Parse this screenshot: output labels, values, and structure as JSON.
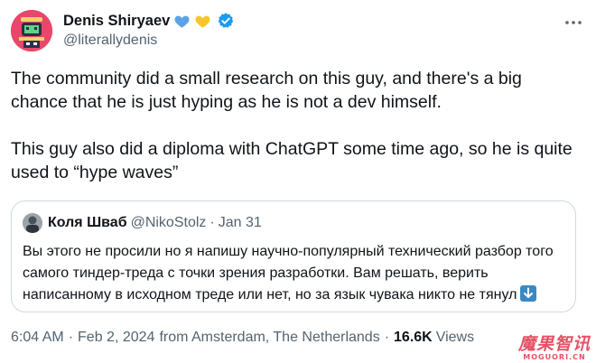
{
  "author": {
    "display_name": "Denis Shiryaev",
    "handle": "@literallydenis",
    "verified": true,
    "avatar_icon": "robot-avatar-icon",
    "badges": [
      "blue-heart-icon",
      "yellow-heart-icon"
    ]
  },
  "tweet": {
    "paragraphs": [
      "The community did a small research on this guy, and there's a big chance that he is just hyping as he is not a dev himself.",
      "This guy also did a diploma with ChatGPT some time ago, so he is quite used to “hype waves”"
    ]
  },
  "quote": {
    "display_name": "Коля Шваб",
    "handle": "@NikoStolz",
    "separator": "·",
    "date": "Jan 31",
    "text": "Вы этого не просили но я напишу научно-популярный технический разбор того самого тиндер-треда с точки зрения разработки. Вам решать, верить написанному в исходном треде или нет, но за язык чувака никто не тянул",
    "trailing_emoji": "down-arrow-emoji-icon"
  },
  "meta": {
    "time": "6:04 AM",
    "date": "Feb 2, 2024",
    "location": "from Amsterdam, The Netherlands",
    "separator": "·",
    "views_count": "16.6K",
    "views_label": "Views"
  },
  "watermark": {
    "main": "魔果智讯",
    "sub": "MOGUORI.CN"
  },
  "colors": {
    "text_primary": "#0f1419",
    "text_secondary": "#536471",
    "verified_blue": "#1d9bf0",
    "border": "#cfd9de"
  }
}
